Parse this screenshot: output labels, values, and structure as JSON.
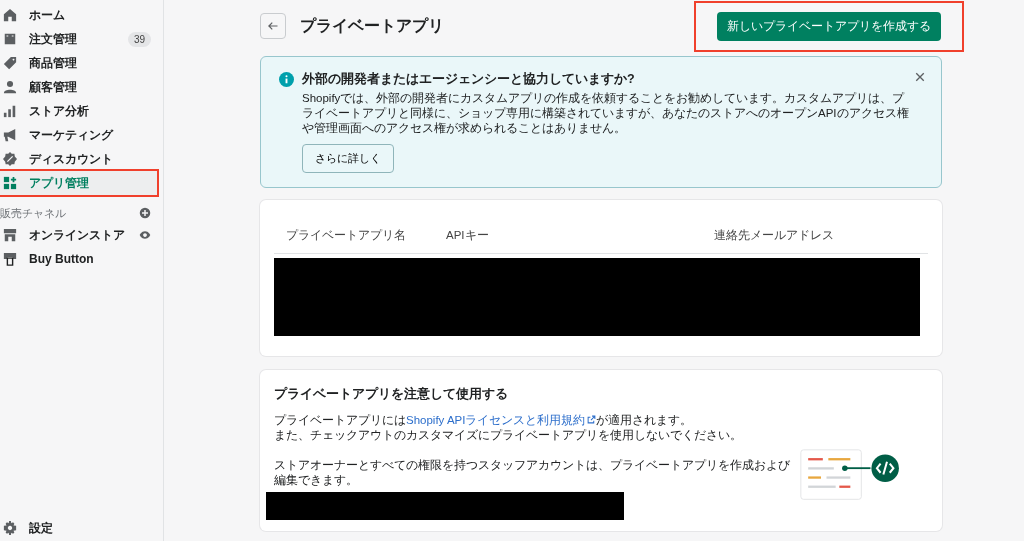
{
  "sidebar": {
    "items": [
      {
        "label": "ホーム",
        "selected": false,
        "highlighted": false
      },
      {
        "label": "注文管理",
        "selected": false,
        "highlighted": false,
        "badge": "39"
      },
      {
        "label": "商品管理",
        "selected": false,
        "highlighted": false
      },
      {
        "label": "顧客管理",
        "selected": false,
        "highlighted": false
      },
      {
        "label": "ストア分析",
        "selected": false,
        "highlighted": false
      },
      {
        "label": "マーケティング",
        "selected": false,
        "highlighted": false
      },
      {
        "label": "ディスカウント",
        "selected": false,
        "highlighted": false
      },
      {
        "label": "アプリ管理",
        "selected": true,
        "highlighted": true
      }
    ],
    "section": {
      "title": "販売チャネル",
      "channels": [
        {
          "label": "オンラインストア"
        },
        {
          "label": "Buy Button"
        }
      ]
    },
    "footer": {
      "label": "設定"
    }
  },
  "page": {
    "title": "プライベートアプリ",
    "primary_button": {
      "label": "新しいプライベートアプリを作成する",
      "highlighted": true
    }
  },
  "banner": {
    "title": "外部の開発者またはエージェンシーと協力していますか?",
    "body": "Shopifyでは、外部の開発者にカスタムアプリの作成を依頼することをお勧めしています。カスタムアプリは、プライベートアプリと同様に、ショップ専用に構築されていますが、あなたのストアへのオープンAPIのアクセス権や管理画面へのアクセス権が求められることはありません。",
    "button": "さらに詳しく"
  },
  "table": {
    "columns": [
      "プライベートアプリ名",
      "APIキー",
      "連絡先メールアドレス"
    ],
    "rows_redacted": true
  },
  "caution": {
    "title": "プライベートアプリを注意して使用する",
    "line_1_before": "プライベートアプリには",
    "link": "Shopify APIライセンスと利用規約",
    "line_1_after": "が適用されます。",
    "line_2": "また、チェックアウトのカスタマイズにプライベートアプリを使用しないでください。",
    "line_3": "ストアオーナーとすべての権限を持つスタッフアカウントは、プライベートアプリを作成および編集できます。",
    "redacted": true
  }
}
